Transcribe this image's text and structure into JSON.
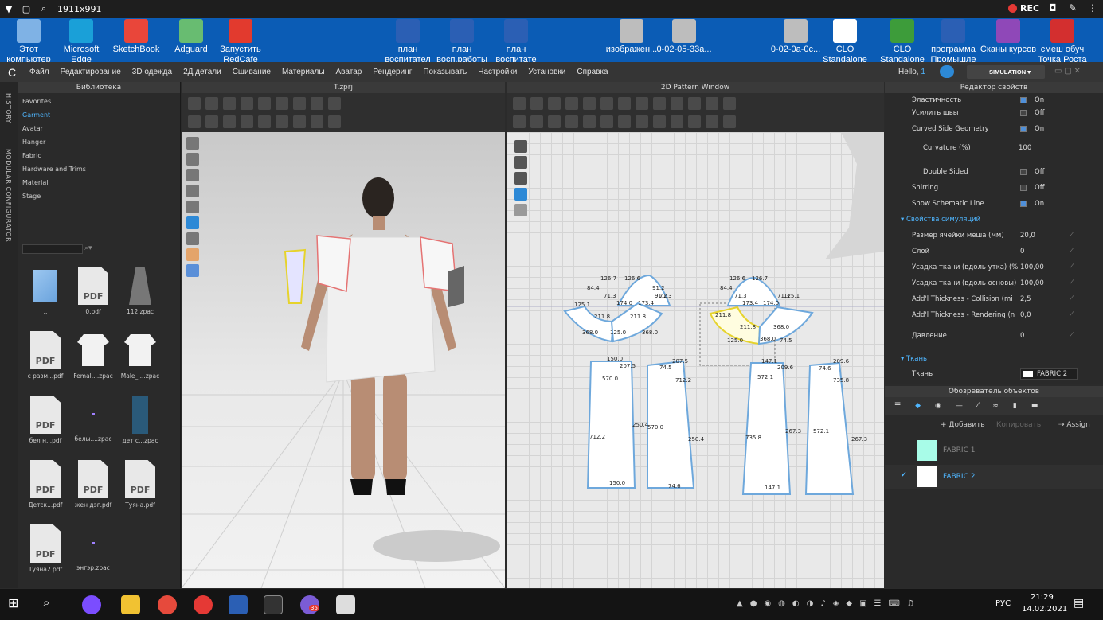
{
  "recbar": {
    "title": "1911x991",
    "rec": "REC"
  },
  "desktop": {
    "icons": [
      {
        "label": "Этот компьютер",
        "color": "#7fb2e5"
      },
      {
        "label": "Microsoft Edge",
        "color": "#1aa0d8"
      },
      {
        "label": "SketchBook",
        "color": "#e9463a"
      },
      {
        "label": "Adguard",
        "color": "#68bc71"
      },
      {
        "label": "Запустить RedCafe",
        "color": "#e23a2e"
      },
      {
        "label": "план воспитател",
        "color": "#2b5fb4"
      },
      {
        "label": "план восп.работы",
        "color": "#2b5fb4"
      },
      {
        "label": "план воспитате",
        "color": "#2b5fb4"
      },
      {
        "label": "изображен...",
        "color": "#bdbdbd"
      },
      {
        "label": "0-02-05-33а...",
        "color": "#bdbdbd"
      },
      {
        "label": "0-02-0а-0с...",
        "color": "#bdbdbd"
      },
      {
        "label": "CLO Standalone",
        "color": "#ffffff"
      },
      {
        "label": "CLO Standalone",
        "color": "#3d9c3a"
      },
      {
        "label": "программа Промышле",
        "color": "#2b5fb4"
      },
      {
        "label": "Сканы курсов",
        "color": "#8f48b8"
      },
      {
        "label": "смеш обуч Точка Роста",
        "color": "#d32f2f"
      }
    ]
  },
  "menubar": {
    "items": [
      "Файл",
      "Редактирование",
      "3D одежда",
      "2Д детали",
      "Сшивание",
      "Материалы",
      "Аватар",
      "Рендеринг",
      "Показывать",
      "Настройки",
      "Установки",
      "Справка"
    ],
    "hello": "Hello,",
    "user": "1",
    "simulation": "SIMULATION"
  },
  "leftstrip": {
    "history": "HISTORY",
    "modular": "MODULAR CONFIGURATOR"
  },
  "library": {
    "title": "Библиотека",
    "items": [
      "Favorites",
      "Garment",
      "Avatar",
      "Hanger",
      "Fabric",
      "Hardware and Trims",
      "Material",
      "Stage"
    ],
    "files": [
      {
        "name": "..",
        "kind": "folder"
      },
      {
        "name": "0.pdf",
        "kind": "pdf"
      },
      {
        "name": "112.zpac",
        "kind": "garment"
      },
      {
        "name": "с разм...pdf",
        "kind": "pdf"
      },
      {
        "name": "Femal....zpac",
        "kind": "tshirt"
      },
      {
        "name": "Male_....zpac",
        "kind": "tshirt"
      },
      {
        "name": "бел н...pdf",
        "kind": "pdf"
      },
      {
        "name": "белы....zpac",
        "kind": "dot"
      },
      {
        "name": "дет с...zpac",
        "kind": "garment2"
      },
      {
        "name": "Детск...pdf",
        "kind": "pdf"
      },
      {
        "name": "жен дэг.pdf",
        "kind": "pdf"
      },
      {
        "name": "Туяна.pdf",
        "kind": "pdf"
      },
      {
        "name": "Туяна2.pdf",
        "kind": "pdf"
      },
      {
        "name": "энгэр.zpac",
        "kind": "dot"
      }
    ],
    "pdf_label": "PDF"
  },
  "view3d": {
    "title": "T.zprj"
  },
  "view2d": {
    "title": "2D Pattern Window",
    "labels": [
      "126.7",
      "126.6",
      "91.2",
      "84.4",
      "71.3",
      "174.0",
      "173.4",
      "91.2",
      "71.3",
      "125.1",
      "211.8",
      "211.8",
      "125.0",
      "368.0",
      "368.0",
      "126.6",
      "126.7",
      "84.4",
      "71.3",
      "173.4",
      "174.0",
      "71.3",
      "125.1",
      "211.8",
      "211.8",
      "368.0",
      "125.0",
      "368.0",
      "74.5",
      "150.0",
      "207.5",
      "570.0",
      "712.2",
      "250.4",
      "150.0",
      "74.5",
      "207.5",
      "712.2",
      "570.0",
      "250.4",
      "74.6",
      "147.1",
      "209.6",
      "572.1",
      "735.8",
      "267.3",
      "147.1",
      "74.6",
      "209.6",
      "735.8",
      "572.1",
      "267.3"
    ]
  },
  "props": {
    "title": "Редактор свойств",
    "rows": [
      {
        "label": "Эластичность",
        "value": "On"
      },
      {
        "label": "Усилить швы",
        "value": "Off"
      },
      {
        "label": "Curved Side Geometry",
        "value": "On"
      },
      {
        "label": "Curvature (%)",
        "value": "100"
      },
      {
        "label": "Double Sided",
        "value": "Off"
      },
      {
        "label": "Shirring",
        "value": "Off"
      },
      {
        "label": "Show Schematic Line",
        "value": "On"
      }
    ],
    "section_sim": "Свойства симуляций",
    "sim_rows": [
      {
        "label": "Размер ячейки меша (мм)",
        "value": "20,0"
      },
      {
        "label": "Слой",
        "value": "0"
      },
      {
        "label": "Усадка ткани (вдоль утка) (%",
        "value": "100,00"
      },
      {
        "label": "Усадка ткани (вдоль основы)",
        "value": "100,00"
      },
      {
        "label": "Add'l Thickness - Collision (mi",
        "value": "2,5"
      },
      {
        "label": "Add'l Thickness - Rendering (n",
        "value": "0,0"
      },
      {
        "label": "Давление",
        "value": "0"
      }
    ],
    "section_fabric": "Ткань",
    "fabric_label": "Ткань",
    "fabric_value": "FABRIC 2"
  },
  "objects": {
    "title": "Обозреватель объектов",
    "add": "Добавить",
    "copy": "Копировать",
    "assign": "Assign",
    "fabrics": [
      {
        "name": "FABRIC 1",
        "color": "#a8fce8",
        "checked": false
      },
      {
        "name": "FABRIC 2",
        "color": "#ffffff",
        "checked": true
      }
    ]
  },
  "taskbar": {
    "lang": "РУС",
    "time": "21:29",
    "date": "14.02.2021",
    "viber_badge": "35"
  }
}
